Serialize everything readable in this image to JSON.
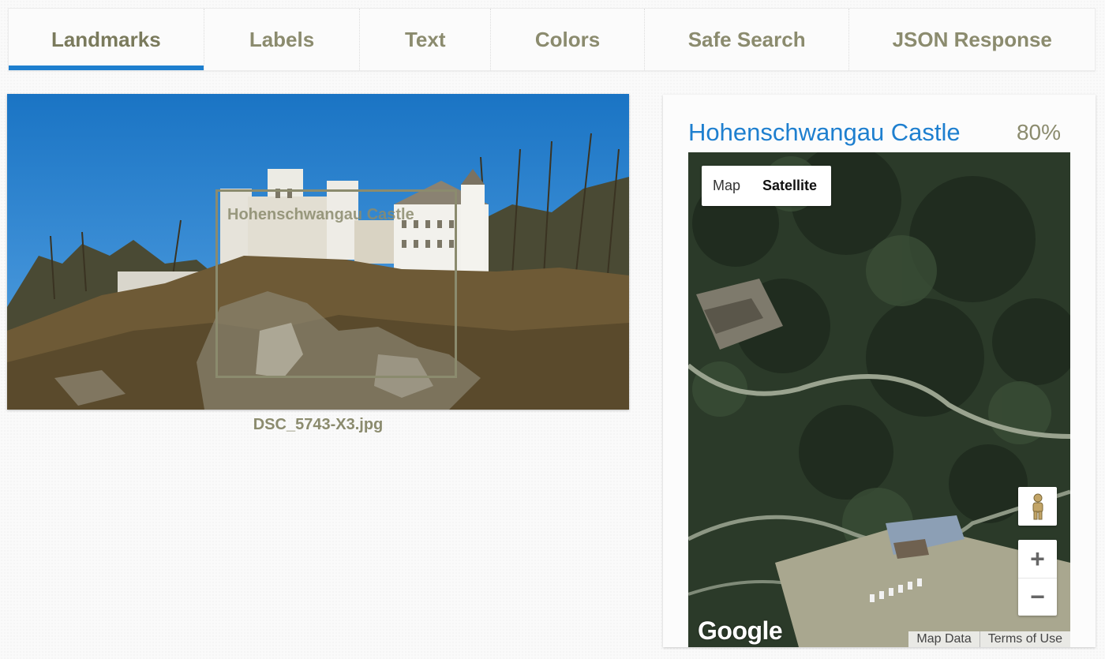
{
  "tabs": [
    {
      "label": "Landmarks",
      "active": true
    },
    {
      "label": "Labels",
      "active": false
    },
    {
      "label": "Text",
      "active": false
    },
    {
      "label": "Colors",
      "active": false
    },
    {
      "label": "Safe Search",
      "active": false
    },
    {
      "label": "JSON Response",
      "active": false
    }
  ],
  "photo": {
    "filename": "DSC_5743-X3.jpg",
    "bbox_label": "Hohenschwangau Castle"
  },
  "result": {
    "landmark_name": "Hohenschwangau Castle",
    "score": "80%"
  },
  "map": {
    "type_map": "Map",
    "type_satellite": "Satellite",
    "selected_type": "Satellite",
    "zoom_in": "+",
    "zoom_out": "−",
    "logo": "Google",
    "map_data": "Map Data",
    "terms": "Terms of Use",
    "pegman_icon": "pegman-icon"
  },
  "colors": {
    "accent": "#1e7fcf",
    "text_muted": "#8b8b6e"
  }
}
